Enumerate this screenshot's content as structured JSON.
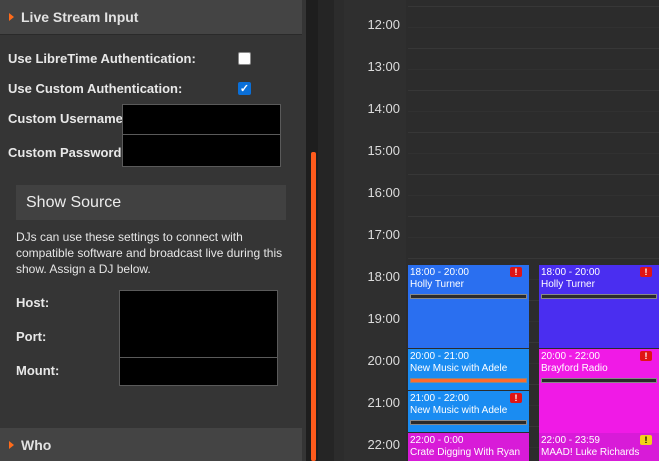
{
  "settings": {
    "live_stream_header": "Live Stream Input",
    "libretime_auth_label": "Use LibreTime Authentication:",
    "libretime_auth_checked": false,
    "custom_auth_label": "Use Custom Authentication:",
    "custom_auth_checked": true,
    "custom_username_label": "Custom Username",
    "custom_password_label": "Custom Password",
    "show_source_header": "Show Source",
    "show_source_desc": "DJs can use these settings to connect with compatible software and broadcast live during this show. Assign a DJ below.",
    "host_label": "Host:",
    "port_label": "Port:",
    "mount_label": "Mount:",
    "who_header": "Who"
  },
  "calendar": {
    "hours": [
      "12:00",
      "13:00",
      "14:00",
      "15:00",
      "16:00",
      "17:00",
      "18:00",
      "19:00",
      "20:00",
      "21:00",
      "22:00"
    ],
    "events": [
      {
        "time": "18:00 - 20:00",
        "name": "Holly Turner",
        "color": "#2a6ff0",
        "badge": "!",
        "badge_color": "red",
        "progress": 0
      },
      {
        "time": "20:00 - 21:00",
        "name": "New Music with Adele",
        "color": "#1a8cf2",
        "badge": "",
        "badge_color": "",
        "progress": 1
      },
      {
        "time": "21:00 - 22:00",
        "name": "New Music with Adele",
        "color": "#1a8cf2",
        "badge": "!",
        "badge_color": "red",
        "progress": 0
      },
      {
        "time": "22:00 - 0:00",
        "name": "Crate Digging With Ryan",
        "color": "#d81bd8",
        "badge": "",
        "badge_color": "",
        "progress": 0
      },
      {
        "time": "18:00 - 20:00",
        "name": "Holly Turner",
        "color": "#4a2ef0",
        "badge": "!",
        "badge_color": "red",
        "progress": 0
      },
      {
        "time": "20:00 - 22:00",
        "name": "Brayford Radio",
        "color": "#f01ae6",
        "badge": "!",
        "badge_color": "red",
        "progress": 0
      },
      {
        "time": "22:00 - 23:59",
        "name": "MAAD! Luke Richards",
        "color": "#d81bd8",
        "badge": "!",
        "badge_color": "yellow",
        "progress": 0
      }
    ]
  }
}
